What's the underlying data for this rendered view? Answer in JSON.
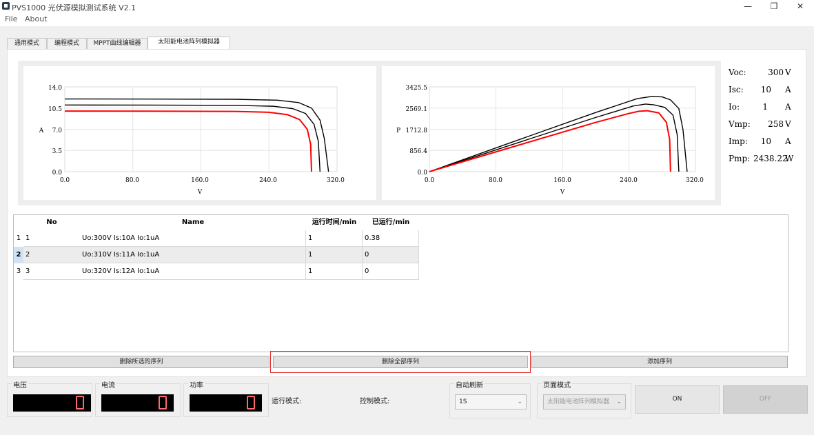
{
  "window": {
    "title": "PVS1000 光伏源模拟测试系统 V2.1",
    "controls": {
      "minimize": "—",
      "restore": "❐",
      "close": "✕"
    }
  },
  "menu": {
    "items": [
      "File",
      "About"
    ]
  },
  "tabs": [
    {
      "label": "通用模式"
    },
    {
      "label": "编程模式"
    },
    {
      "label": "MPPT曲线编辑器"
    },
    {
      "label": "太阳能电池阵列模拟器",
      "active": true
    }
  ],
  "iv_chart": {
    "ylabel": "A",
    "xlabel": "V",
    "yticks": [
      "0.0",
      "3.5",
      "7.0",
      "10.5",
      "14.0"
    ],
    "xticks": [
      "0.0",
      "80.0",
      "160.0",
      "240.0",
      "320.0"
    ]
  },
  "pv_chart": {
    "ylabel": "P",
    "xlabel": "V",
    "yticks": [
      "0.0",
      "856.4",
      "1712.8",
      "2569.1",
      "3425.5"
    ],
    "xticks": [
      "0.0",
      "80.0",
      "160.0",
      "240.0",
      "320.0"
    ]
  },
  "chart_data": [
    {
      "type": "line",
      "xlabel": "V",
      "ylabel": "A",
      "xlim": [
        0,
        320
      ],
      "ylim": [
        0,
        14
      ],
      "grid": true,
      "series": [
        {
          "color": "#000000",
          "x": [
            0,
            100,
            200,
            250,
            275,
            290,
            300,
            305,
            310
          ],
          "y": [
            12,
            11.99,
            11.95,
            11.8,
            11.4,
            10.5,
            8.5,
            5.5,
            0
          ]
        },
        {
          "color": "#000000",
          "x": [
            0,
            100,
            200,
            245,
            268,
            283,
            293,
            298,
            300
          ],
          "y": [
            11,
            10.99,
            10.95,
            10.8,
            10.4,
            9.6,
            7.8,
            5,
            0
          ]
        },
        {
          "color": "#ff0000",
          "x": [
            0,
            100,
            200,
            240,
            262,
            276,
            285,
            289,
            290
          ],
          "y": [
            10,
            9.99,
            9.95,
            9.8,
            9.4,
            8.6,
            7,
            4.5,
            0
          ]
        }
      ]
    },
    {
      "type": "line",
      "xlabel": "V",
      "ylabel": "P",
      "xlim": [
        0,
        320
      ],
      "ylim": [
        0,
        3425.5
      ],
      "grid": true,
      "series": [
        {
          "color": "#000000",
          "x": [
            0,
            100,
            200,
            250,
            268,
            280,
            290,
            300,
            305,
            310
          ],
          "y": [
            0,
            1199,
            2390,
            2950,
            3040,
            3020,
            2900,
            2550,
            1700,
            0
          ]
        },
        {
          "color": "#000000",
          "x": [
            0,
            100,
            200,
            245,
            260,
            270,
            283,
            293,
            298,
            300
          ],
          "y": [
            0,
            1099,
            2190,
            2650,
            2730,
            2700,
            2600,
            2285,
            1500,
            0
          ]
        },
        {
          "color": "#ff0000",
          "x": [
            0,
            100,
            200,
            240,
            252,
            262,
            276,
            285,
            289,
            290
          ],
          "y": [
            0,
            999,
            1990,
            2352,
            2440,
            2462,
            2374,
            1995,
            1300,
            0
          ]
        }
      ]
    }
  ],
  "params": [
    {
      "label": "Voc:",
      "value": "300",
      "unit": "V"
    },
    {
      "label": "Isc:",
      "value": "10",
      "unit": "A"
    },
    {
      "label": "Io:",
      "value": "1",
      "unit": "A"
    },
    {
      "label": "Vmp:",
      "value": "258",
      "unit": "V"
    },
    {
      "label": "Imp:",
      "value": "10",
      "unit": "A"
    },
    {
      "label": "Pmp:",
      "value": "2438.22",
      "unit": "W"
    }
  ],
  "table": {
    "headers": [
      "No",
      "Name",
      "运行时间/min",
      "已运行/min"
    ],
    "rows": [
      {
        "row_header": "1",
        "no": "1",
        "name": "Uo:300V  Is:10A  Io:1uA",
        "run_time": "1",
        "elapsed": "0.38"
      },
      {
        "row_header": "2",
        "no": "2",
        "name": "Uo:310V  Is:11A  Io:1uA",
        "run_time": "1",
        "elapsed": "0"
      },
      {
        "row_header": "3",
        "no": "3",
        "name": "Uo:320V  Is:12A  Io:1uA",
        "run_time": "1",
        "elapsed": "0"
      }
    ]
  },
  "actions": {
    "delete_selected": "删除所选的序列",
    "delete_all": "删除全部序列",
    "add": "添加序列"
  },
  "status": {
    "voltage_label": "电压",
    "current_label": "电流",
    "power_label": "功率",
    "run_mode_label": "运行模式:",
    "control_mode_label": "控制模式:",
    "auto_refresh_label": "自动刷新",
    "auto_refresh_value": "1S",
    "page_mode_label": "页面模式",
    "page_mode_value": "太阳能电池阵列模拟器",
    "on_label": "ON",
    "off_label": "OFF"
  }
}
